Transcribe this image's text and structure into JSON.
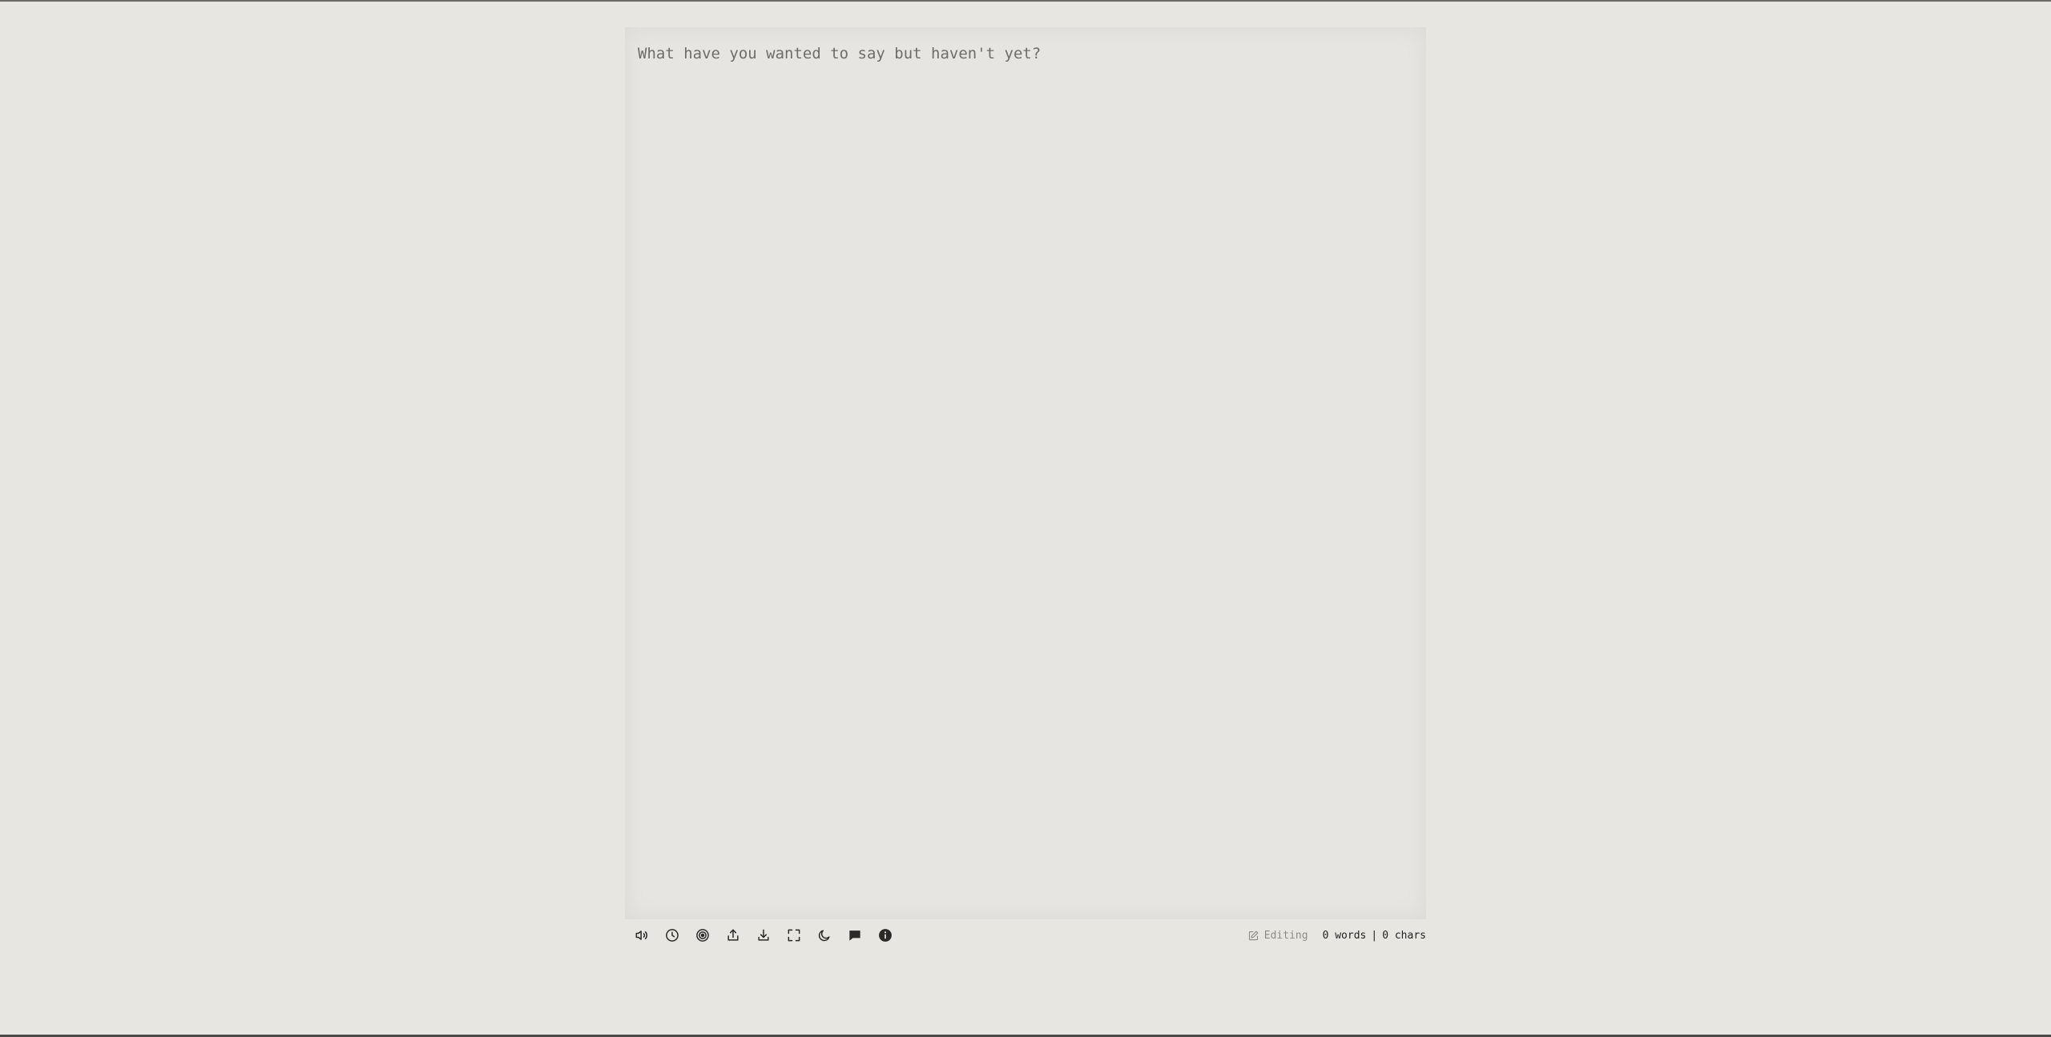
{
  "editor": {
    "placeholder": "What have you wanted to say but haven't yet?",
    "value": ""
  },
  "toolbar": {
    "icons": [
      "sound-icon",
      "timer-icon",
      "target-icon",
      "upload-icon",
      "download-icon",
      "fullscreen-icon",
      "dark-mode-icon",
      "chat-icon",
      "info-icon"
    ]
  },
  "status": {
    "mode": "Editing",
    "words": "0 words",
    "separator": "|",
    "chars": "0 chars"
  },
  "colors": {
    "background": "#e8e6e1",
    "paper": "#e6e5e1",
    "text": "#2a2a2a",
    "muted": "#8d8b87"
  }
}
